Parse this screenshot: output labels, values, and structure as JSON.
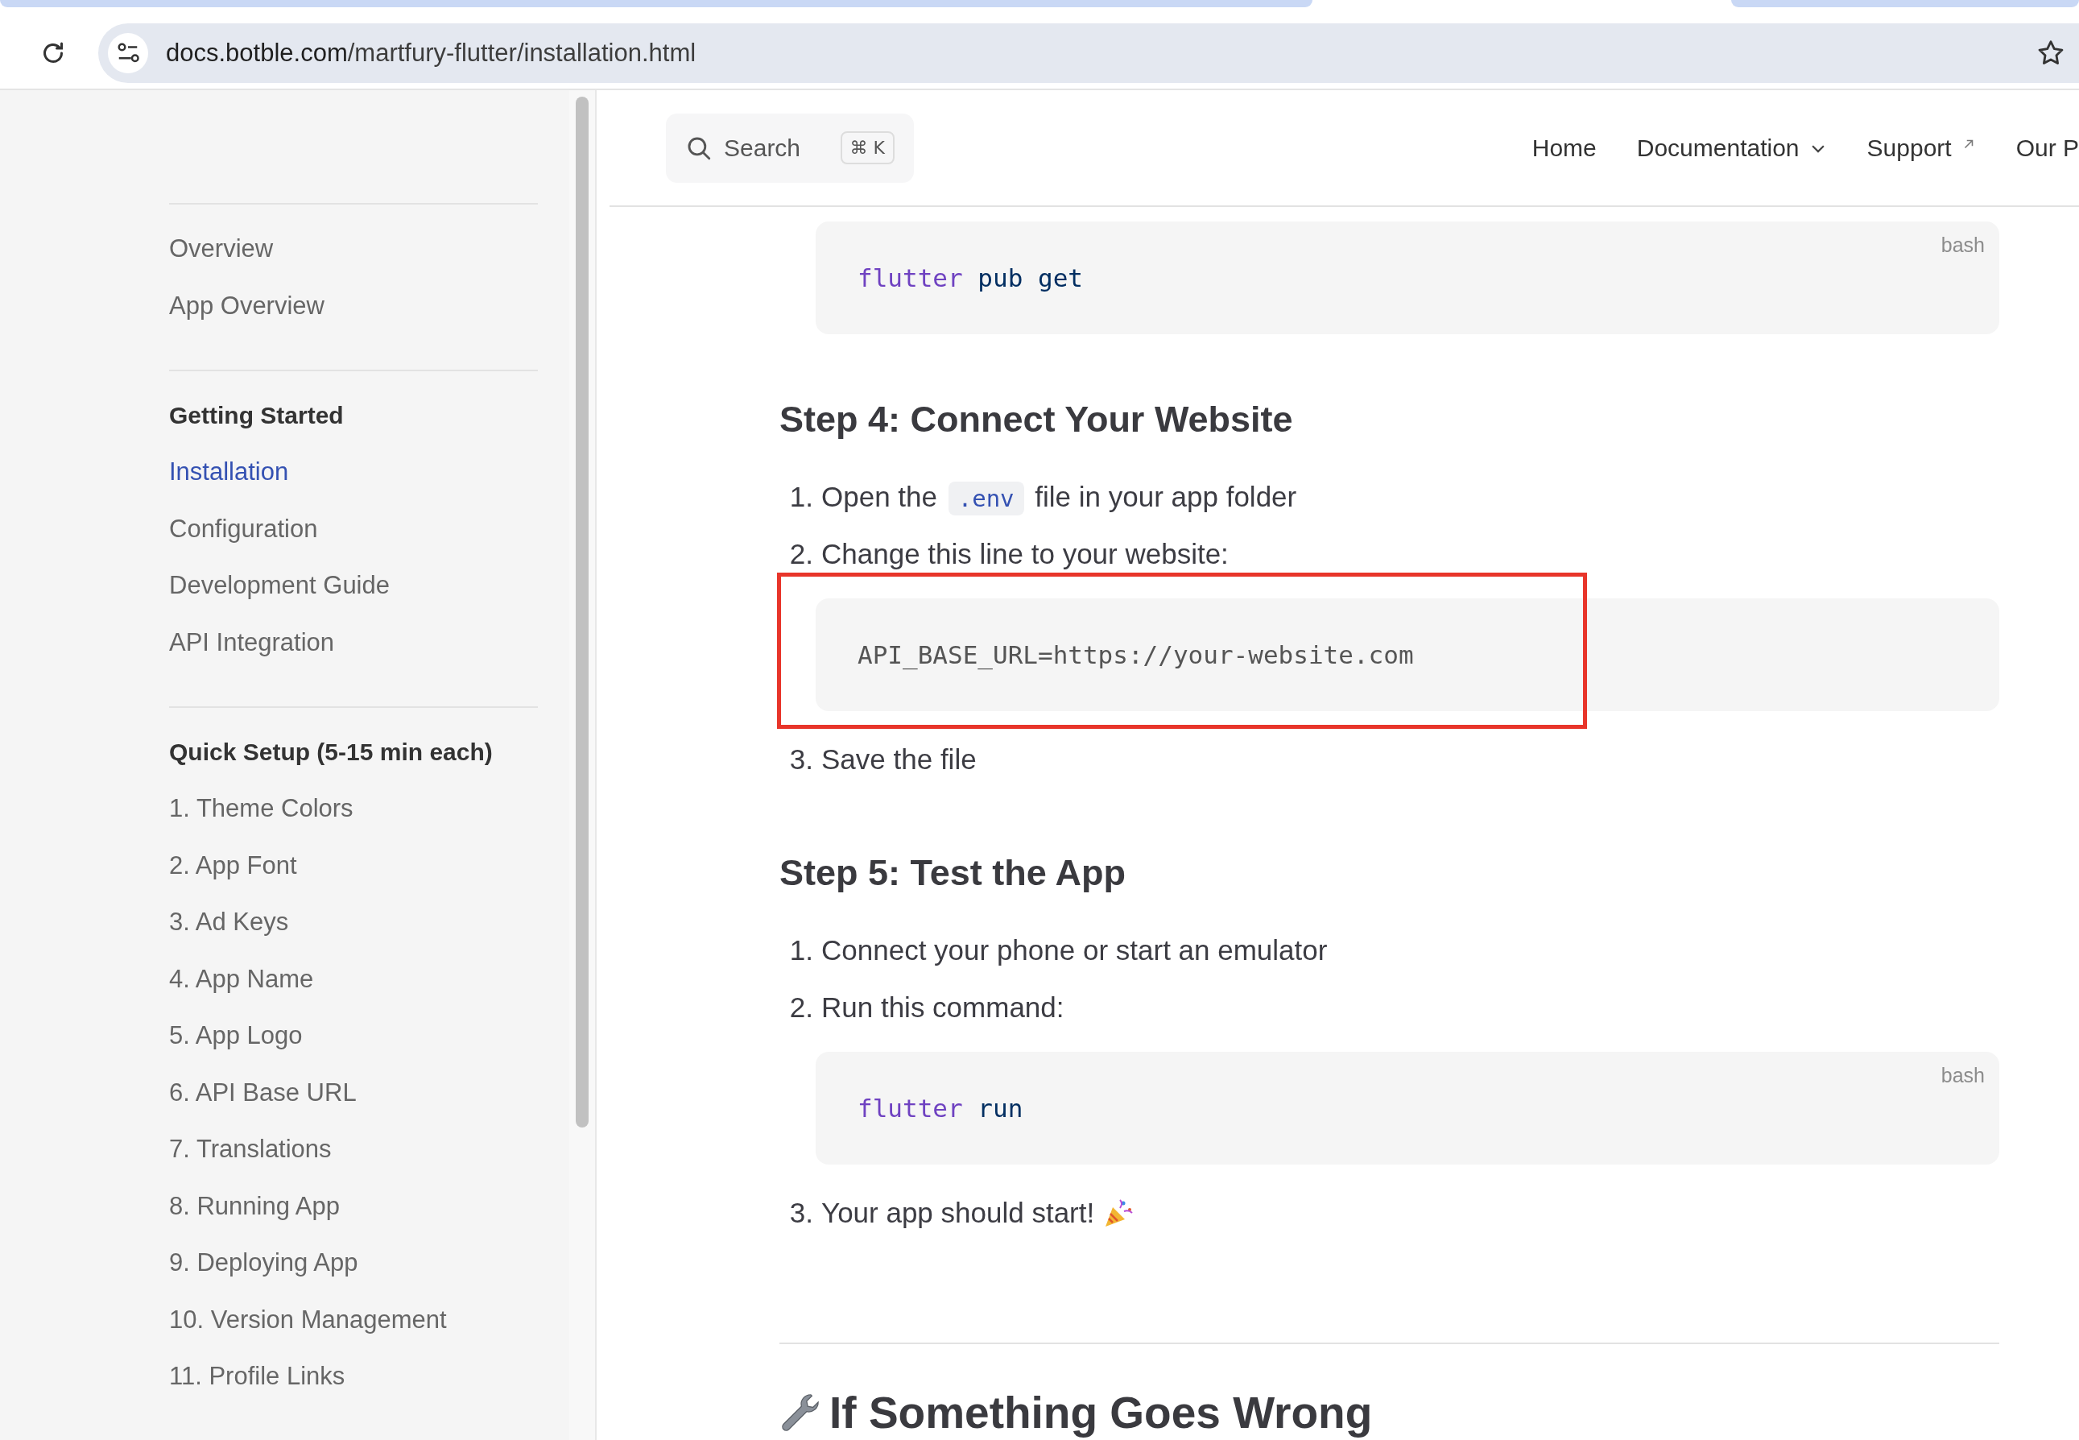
{
  "browser": {
    "url_host": "docs.botble.com",
    "url_path": "/martfury-flutter/installation.html"
  },
  "sidebar": {
    "sections": [
      {
        "items": [
          {
            "label": "Overview",
            "selected": false
          },
          {
            "label": "App Overview",
            "selected": false
          }
        ]
      },
      {
        "title": "Getting Started",
        "items": [
          {
            "label": "Installation",
            "selected": true
          },
          {
            "label": "Configuration",
            "selected": false
          },
          {
            "label": "Development Guide",
            "selected": false
          },
          {
            "label": "API Integration",
            "selected": false
          }
        ]
      },
      {
        "title": "Quick Setup (5-15 min each)",
        "items": [
          {
            "label": "1. Theme Colors",
            "selected": false
          },
          {
            "label": "2. App Font",
            "selected": false
          },
          {
            "label": "3. Ad Keys",
            "selected": false
          },
          {
            "label": "4. App Name",
            "selected": false
          },
          {
            "label": "5. App Logo",
            "selected": false
          },
          {
            "label": "6. API Base URL",
            "selected": false
          },
          {
            "label": "7. Translations",
            "selected": false
          },
          {
            "label": "8. Running App",
            "selected": false
          },
          {
            "label": "9. Deploying App",
            "selected": false
          },
          {
            "label": "10. Version Management",
            "selected": false
          },
          {
            "label": "11. Profile Links",
            "selected": false
          }
        ]
      }
    ]
  },
  "header": {
    "search": {
      "placeholder": "Search",
      "shortcut": "⌘ K"
    },
    "nav": [
      {
        "label": "Home",
        "kind": "link"
      },
      {
        "label": "Documentation",
        "kind": "dropdown"
      },
      {
        "label": "Support",
        "kind": "external"
      },
      {
        "label": "Our P",
        "kind": "link"
      }
    ]
  },
  "content": [
    {
      "kind": "code",
      "language": "bash",
      "highlighted": false,
      "tokens": [
        {
          "text": "flutter",
          "kind": "command"
        },
        {
          "text": " pub get",
          "kind": "arg"
        }
      ]
    },
    {
      "kind": "heading",
      "text": "Step 4: Connect Your Website"
    },
    {
      "kind": "list",
      "items": [
        {
          "number": "1.",
          "parts": [
            {
              "text": "Open the "
            },
            {
              "text": ".env",
              "kind": "code"
            },
            {
              "text": " file in your app folder"
            }
          ]
        },
        {
          "number": "2.",
          "parts": [
            {
              "text": "Change this line to your website:"
            }
          ]
        }
      ]
    },
    {
      "kind": "code",
      "highlighted": true,
      "tokens": [
        {
          "text": "API_BASE_URL=https://your-website.com",
          "kind": "plain"
        }
      ]
    },
    {
      "kind": "list",
      "items": [
        {
          "number": "3.",
          "parts": [
            {
              "text": "Save the file"
            }
          ]
        }
      ]
    },
    {
      "kind": "heading",
      "text": "Step 5: Test the App"
    },
    {
      "kind": "list",
      "items": [
        {
          "number": "1.",
          "parts": [
            {
              "text": "Connect your phone or start an emulator"
            }
          ]
        },
        {
          "number": "2.",
          "parts": [
            {
              "text": "Run this command:"
            }
          ]
        }
      ]
    },
    {
      "kind": "code",
      "language": "bash",
      "highlighted": false,
      "tokens": [
        {
          "text": "flutter",
          "kind": "command"
        },
        {
          "text": " run",
          "kind": "arg"
        }
      ]
    },
    {
      "kind": "list",
      "items": [
        {
          "number": "3.",
          "icon": true,
          "parts": [
            {
              "text": "Your app should start!"
            }
          ]
        }
      ]
    },
    {
      "kind": "rule"
    },
    {
      "kind": "title",
      "icon": true,
      "text": "If Something Goes Wrong"
    }
  ]
}
